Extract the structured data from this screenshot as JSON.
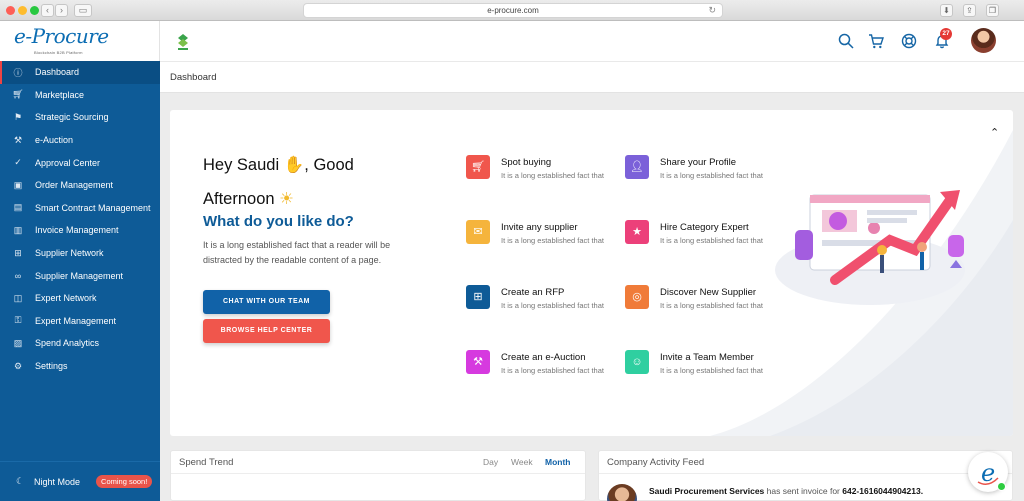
{
  "browser": {
    "url": "e-procure.com"
  },
  "app": {
    "logo_text": "e-Procure",
    "logo_tagline": "Blockchain B2B Platform"
  },
  "sidebar": {
    "items": [
      {
        "label": "Dashboard",
        "icon": "info-icon"
      },
      {
        "label": "Marketplace",
        "icon": "cart-icon"
      },
      {
        "label": "Strategic Sourcing",
        "icon": "flag-icon"
      },
      {
        "label": "e-Auction",
        "icon": "gavel-icon"
      },
      {
        "label": "Approval Center",
        "icon": "check-circle-icon"
      },
      {
        "label": "Order Management",
        "icon": "box-icon"
      },
      {
        "label": "Smart Contract Management",
        "icon": "document-icon"
      },
      {
        "label": "Invoice Management",
        "icon": "invoice-icon"
      },
      {
        "label": "Supplier Network",
        "icon": "network-icon"
      },
      {
        "label": "Supplier Management",
        "icon": "handshake-icon"
      },
      {
        "label": "Expert Network",
        "icon": "presentation-icon"
      },
      {
        "label": "Expert Management",
        "icon": "user-lock-icon"
      },
      {
        "label": "Spend Analytics",
        "icon": "chart-icon"
      },
      {
        "label": "Settings",
        "icon": "gear-icon"
      }
    ],
    "night_mode_label": "Night Mode",
    "coming_soon": "Coming soon!"
  },
  "header": {
    "notification_count": "27"
  },
  "breadcrumb": "Dashboard",
  "hero": {
    "greeting_line1": "Hey Saudi",
    "greeting_mid": ", Good",
    "greeting_line2": "Afternoon",
    "question": "What do you like do?",
    "description": "It is a long established fact that a reader will be distracted by the readable content of a page.",
    "chat_button": "CHAT WITH OUR TEAM",
    "help_button": "BROWSE HELP CENTER",
    "actions": [
      {
        "title": "Spot buying",
        "desc": "It is a long established fact that",
        "color": "#f0564c",
        "icon": "cart-icon"
      },
      {
        "title": "Share your Profile",
        "desc": "It is a long established fact that",
        "color": "#7b61d9",
        "icon": "user-share-icon"
      },
      {
        "title": "Invite any supplier",
        "desc": "It is a long established fact that",
        "color": "#f5b43c",
        "icon": "invite-icon"
      },
      {
        "title": "Hire Category Expert",
        "desc": "It is a long established fact that",
        "color": "#ec407a",
        "icon": "expert-icon"
      },
      {
        "title": "Create an RFP",
        "desc": "It is a long established fact that",
        "color": "#0e5b97",
        "icon": "plus-square-icon"
      },
      {
        "title": "Discover New Supplier",
        "desc": "It is a long established fact that",
        "color": "#f07b39",
        "icon": "discover-icon"
      },
      {
        "title": "Create an e-Auction",
        "desc": "It is a long established fact that",
        "color": "#d63adf",
        "icon": "gavel-icon"
      },
      {
        "title": "Invite a Team Member",
        "desc": "It is a long established fact that",
        "color": "#2fcfa0",
        "icon": "team-icon"
      }
    ]
  },
  "spend_trend": {
    "title": "Spend Trend",
    "periods": [
      "Day",
      "Week",
      "Month"
    ],
    "active_period": "Month"
  },
  "activity_feed": {
    "title": "Company Activity Feed",
    "entry_actor": "Saudi Procurement Services",
    "entry_action": " has sent invoice for ",
    "entry_ref": "642-1616044904213."
  }
}
